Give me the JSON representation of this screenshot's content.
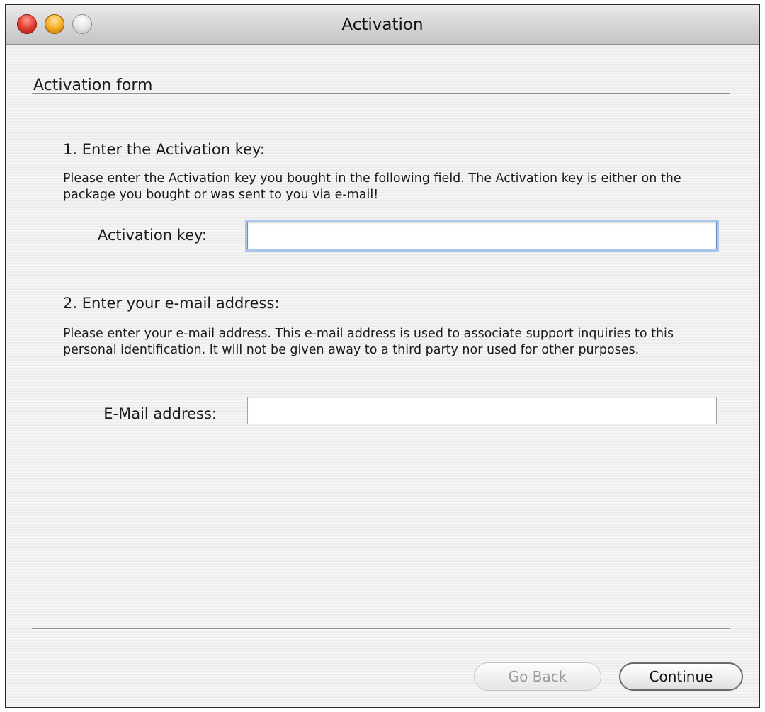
{
  "window": {
    "title": "Activation"
  },
  "form": {
    "section_title": "Activation form",
    "step1": {
      "heading": "1. Enter the Activation key:",
      "description": "Please enter the Activation key you bought in the following field. The Activation key is either on the package you bought or was sent to you via e-mail!",
      "label": "Activation key:",
      "value": ""
    },
    "step2": {
      "heading": "2. Enter your e-mail address:",
      "description": "Please enter your e-mail address. This e-mail address is used to  associate support inquiries to this personal identification. It will not be given away to a third party nor used for other purposes.",
      "label": "E-Mail address:",
      "value": ""
    }
  },
  "buttons": {
    "back_label": "Go Back",
    "continue_label": "Continue"
  },
  "colors": {
    "focus_ring": "#a9c6ea",
    "close": "#e0382a",
    "minimize": "#f2a91e",
    "zoom": "#e2e2e2"
  }
}
